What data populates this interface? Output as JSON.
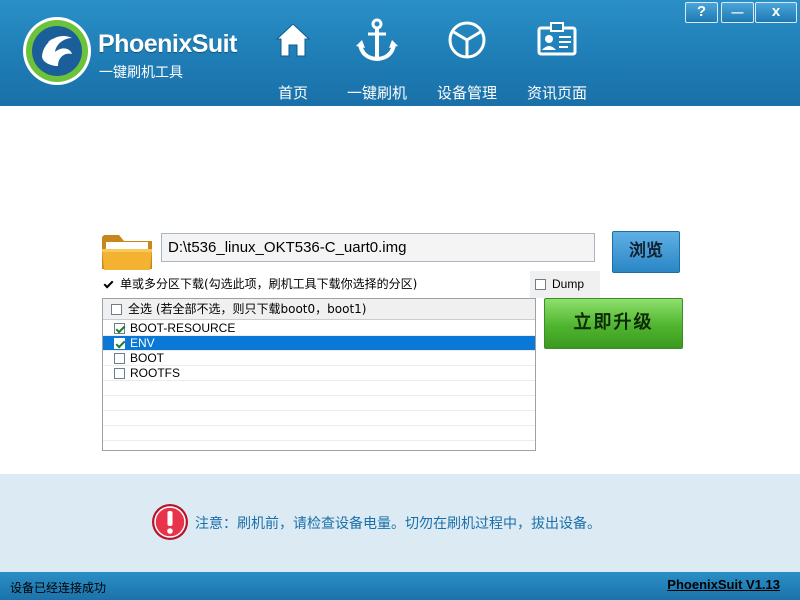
{
  "window": {
    "help_label": "?",
    "minimize_label": "—",
    "close_label": "x"
  },
  "brand": {
    "name": "PhoenixSuit",
    "subtitle": "一键刷机工具"
  },
  "nav": [
    {
      "label": "首页",
      "icon": "home-icon"
    },
    {
      "label": "一键刷机",
      "icon": "anchor-icon"
    },
    {
      "label": "设备管理",
      "icon": "cube-icon"
    },
    {
      "label": "资讯页面",
      "icon": "news-icon"
    }
  ],
  "firmware": {
    "path": "D:\\t536_linux_OKT536-C_uart0.img",
    "browse_label": "浏览"
  },
  "options": {
    "partition_label": "单或多分区下载(勾选此项，刷机工具下载你选择的分区)",
    "partition_checked": true,
    "dump_label": "Dump",
    "dump_checked": false
  },
  "partitions": {
    "select_all_label": "全选 (若全部不选，则只下载boot0，boot1)",
    "items": [
      {
        "name": "BOOT-RESOURCE",
        "checked": true,
        "selected": false
      },
      {
        "name": "ENV",
        "checked": true,
        "selected": true
      },
      {
        "name": "BOOT",
        "checked": false,
        "selected": false
      },
      {
        "name": "ROOTFS",
        "checked": false,
        "selected": false
      }
    ]
  },
  "upgrade_label": "立即升级",
  "notice": "注意：刷机前，请检查设备电量。切勿在刷机过程中，拔出设备。",
  "status": {
    "message": "设备已经连接成功",
    "version": "PhoenixSuit V1.13"
  },
  "colors": {
    "header": "#1f7db6",
    "selection": "#0a78d7",
    "upgrade": "#4fb52f",
    "notice_text": "#1a6faa"
  }
}
